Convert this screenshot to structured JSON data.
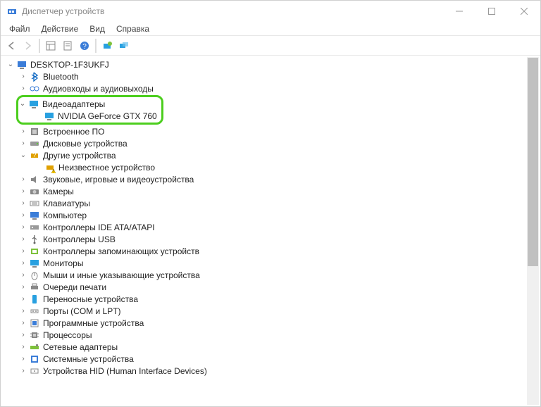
{
  "window": {
    "title": "Диспетчер устройств"
  },
  "menu": {
    "file": "Файл",
    "action": "Действие",
    "view": "Вид",
    "help": "Справка"
  },
  "tree": {
    "root": "DESKTOP-1F3UKFJ",
    "bluetooth": "Bluetooth",
    "audio_io": "Аудиовходы и аудиовыходы",
    "video_adapters": "Видеоадаптеры",
    "gpu": "NVIDIA GeForce GTX 760",
    "embedded": "Встроенное ПО",
    "disk": "Дисковые устройства",
    "other": "Другие устройства",
    "unknown": "Неизвестное устройство",
    "sound": "Звуковые, игровые и видеоустройства",
    "cameras": "Камеры",
    "keyboards": "Клавиатуры",
    "computer": "Компьютер",
    "ide": "Контроллеры IDE ATA/ATAPI",
    "usb": "Контроллеры USB",
    "storage": "Контроллеры запоминающих устройств",
    "monitors": "Мониторы",
    "mice": "Мыши и иные указывающие устройства",
    "print": "Очереди печати",
    "portable": "Переносные устройства",
    "ports": "Порты (COM и LPT)",
    "software": "Программные устройства",
    "processors": "Процессоры",
    "network": "Сетевые адаптеры",
    "system": "Системные устройства",
    "hid": "Устройства HID (Human Interface Devices)"
  }
}
